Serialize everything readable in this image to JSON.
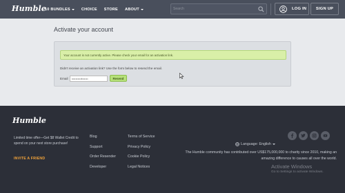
{
  "header": {
    "logo": "Humble",
    "nav": [
      {
        "label": "10 BUNDLES",
        "dropdown": true
      },
      {
        "label": "CHOICE",
        "dropdown": false
      },
      {
        "label": "STORE",
        "dropdown": false
      },
      {
        "label": "ABOUT",
        "dropdown": true
      }
    ],
    "search": {
      "placeholder": "Search",
      "value": ""
    },
    "login_label": "LOG IN",
    "signup_label": "SIGN UP"
  },
  "main": {
    "title": "Activate your account",
    "alert": "Your account is not currently active. Please check your email for an activation link.",
    "resend_prompt": "Didn't receive an activation link? Use the form below to resend the email.",
    "email_label": "Email",
    "email_value": "k•••••••••t••••••",
    "resend_button": "Resend"
  },
  "footer": {
    "logo": "Humble",
    "promo": "Limited time offer—Get $8 Wallet Credit to spend on your next store purchase!",
    "invite": "INVITE A FRIEND",
    "col1": [
      "Blog",
      "Support",
      "Order Resender",
      "Developer"
    ],
    "col2": [
      "Terms of Service",
      "Privacy Policy",
      "Cookie Policy",
      "Legal Notices"
    ],
    "social_icons": [
      "facebook-icon",
      "twitter-icon",
      "instagram-icon",
      "youtube-icon"
    ],
    "language": "Language: English",
    "charity": "The Humble community has contributed over US$175,000,000 to charity since 2010, making an amazing difference to causes all over the world.",
    "watermark_title": "Activate Windows",
    "watermark_sub": "Go to Settings to activate Windows."
  },
  "colors": {
    "header_bg": "#494f5c",
    "footer_bg": "#2c2f38",
    "alert_bg": "#d9efa8",
    "invite": "#f2a33a",
    "button_green": "#b6e07a"
  }
}
